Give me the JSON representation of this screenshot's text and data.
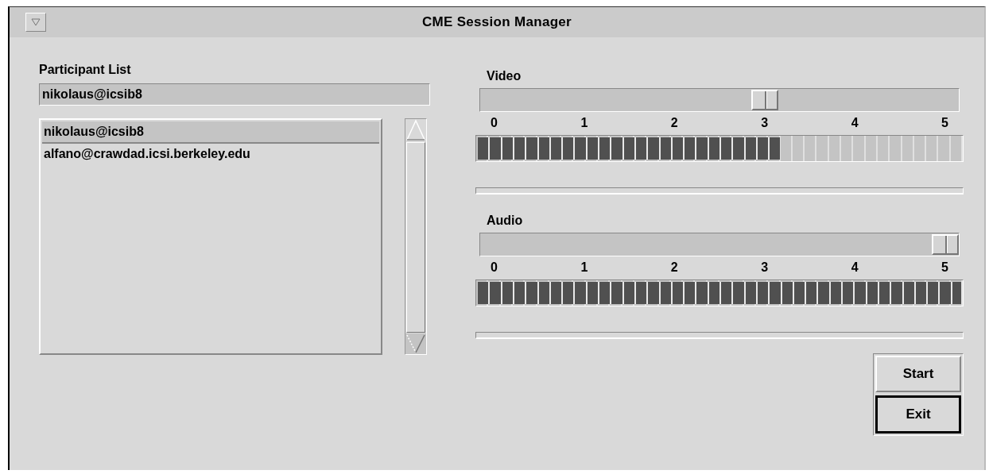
{
  "window": {
    "title": "CME Session Manager"
  },
  "participants": {
    "label": "Participant List",
    "field_value": "nikolaus@icsib8",
    "items": [
      {
        "text": "nikolaus@icsib8",
        "selected": true
      },
      {
        "text": "alfano@crawdad.icsi.berkeley.edu",
        "selected": false
      }
    ]
  },
  "channels": [
    {
      "label": "Video",
      "level": 0.6,
      "ticks": [
        "0",
        "1",
        "2",
        "3",
        "4",
        "5"
      ],
      "meter": {
        "level": 0.625
      }
    },
    {
      "label": "Audio",
      "level": 1.0,
      "ticks": [
        "0",
        "1",
        "2",
        "3",
        "4",
        "5"
      ],
      "meter": {
        "level": 1.0
      }
    }
  ],
  "buttons": [
    {
      "label": "Start",
      "default": false
    },
    {
      "label": "Exit",
      "default": true
    }
  ]
}
